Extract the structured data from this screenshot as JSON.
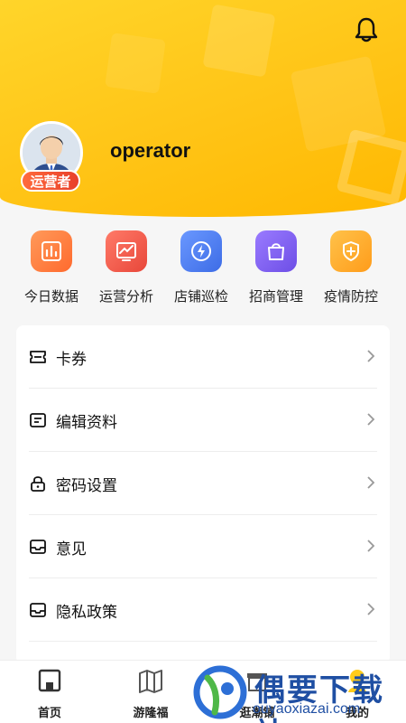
{
  "header": {
    "username": "operator",
    "role_badge": "运营者",
    "bell_icon": "bell-icon"
  },
  "quick_actions": [
    {
      "label": "今日数据",
      "icon": "chart-data-icon",
      "color": "#ff7a3d"
    },
    {
      "label": "运营分析",
      "icon": "trend-analysis-icon",
      "color": "#f25b4b"
    },
    {
      "label": "店铺巡检",
      "icon": "lightning-icon",
      "color": "#4a7cf0"
    },
    {
      "label": "招商管理",
      "icon": "shopping-bag-icon",
      "color": "#7b5cf2"
    },
    {
      "label": "疫情防控",
      "icon": "shield-plus-icon",
      "color": "#ffaa2a"
    }
  ],
  "menu": [
    {
      "label": "卡券",
      "icon": "ticket-icon"
    },
    {
      "label": "编辑资料",
      "icon": "edit-profile-icon"
    },
    {
      "label": "密码设置",
      "icon": "lock-icon"
    },
    {
      "label": "意见",
      "icon": "inbox-icon"
    },
    {
      "label": "隐私政策",
      "icon": "inbox-icon"
    }
  ],
  "tabs": [
    {
      "label": "首页",
      "icon": "home-icon"
    },
    {
      "label": "游隆福",
      "icon": "map-icon"
    },
    {
      "label": "逛潮铺",
      "icon": "shop-icon"
    },
    {
      "label": "我的",
      "icon": "profile-icon"
    }
  ],
  "watermark": {
    "title": "偶要下载站",
    "url": "ouyaoxiazai.com"
  }
}
